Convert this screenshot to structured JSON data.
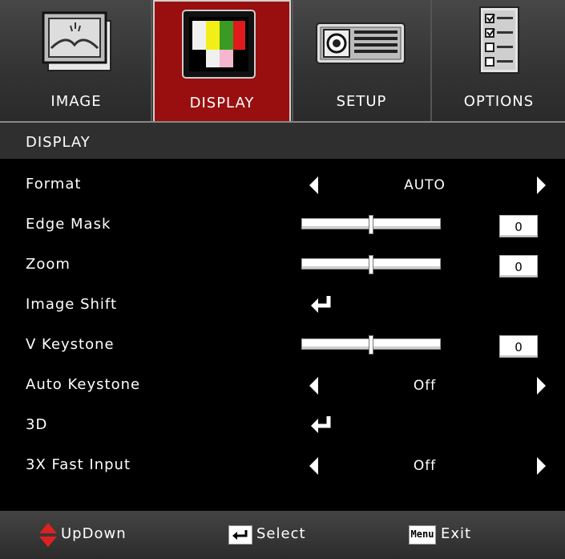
{
  "tabs": [
    {
      "label": "IMAGE",
      "icon": "image-landscape-icon",
      "active": false
    },
    {
      "label": "DISPLAY",
      "icon": "display-color-bars-icon",
      "active": true
    },
    {
      "label": "SETUP",
      "icon": "projector-icon",
      "active": false
    },
    {
      "label": "OPTIONS",
      "icon": "options-checklist-icon",
      "active": false
    }
  ],
  "section_title": "DISPLAY",
  "rows": [
    {
      "label": "Format",
      "type": "select",
      "value": "AUTO"
    },
    {
      "label": "Edge Mask",
      "type": "slider",
      "value": "0",
      "level": 0.5
    },
    {
      "label": "Zoom",
      "type": "slider",
      "value": "0",
      "level": 0.5
    },
    {
      "label": "Image Shift",
      "type": "enter"
    },
    {
      "label": "V Keystone",
      "type": "slider",
      "value": "0",
      "level": 0.5
    },
    {
      "label": "Auto Keystone",
      "type": "select",
      "value": "Off"
    },
    {
      "label": "3D",
      "type": "enter"
    },
    {
      "label": "3X Fast Input",
      "type": "select",
      "value": "Off"
    }
  ],
  "footer": {
    "updown_label": "UpDown",
    "select_label": "Select",
    "menu_key": "Menu",
    "exit_label": "Exit"
  },
  "colors": {
    "active_tab": "#990f0f",
    "updown_arrows": "#e02020"
  }
}
